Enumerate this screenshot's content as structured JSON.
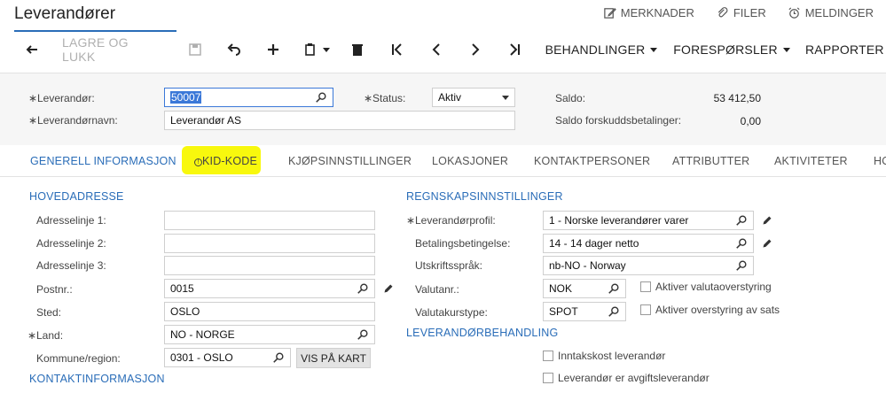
{
  "header": {
    "title": "Leverandører",
    "links": [
      {
        "label": "MERKNADER",
        "icon": "edit-note-icon"
      },
      {
        "label": "FILER",
        "icon": "paperclip-icon"
      },
      {
        "label": "MELDINGER",
        "icon": "alarm-clock-icon"
      }
    ]
  },
  "toolbar": {
    "save_close_label": "LAGRE OG LUKK",
    "actions_label": "BEHANDLINGER",
    "inquiries_label": "FORESPØRSLER",
    "reports_label": "RAPPORTER"
  },
  "summary": {
    "vendor_label": "Leverandør:",
    "vendor_value": "50007",
    "status_label": "Status:",
    "status_value": "Aktiv",
    "vendor_name_label": "Leverandørnavn:",
    "vendor_name_value": "Leverandør AS",
    "balance_label": "Saldo:",
    "balance_value": "53 412,50",
    "prepayment_label": "Saldo forskuddsbetalinger:",
    "prepayment_value": "0,00"
  },
  "tabs": [
    "GENERELL INFORMASJON",
    "KID-KODE",
    "KJØPSINNSTILLINGER",
    "LOKASJONER",
    "KONTAKTPERSONER",
    "ATTRIBUTTER",
    "AKTIVITETER",
    "HO"
  ],
  "address": {
    "section_title": "HOVEDADRESSE",
    "line1_label": "Adresselinje 1:",
    "line1_value": "",
    "line2_label": "Adresselinje 2:",
    "line2_value": "",
    "line3_label": "Adresselinje 3:",
    "line3_value": "",
    "postal_label": "Postnr.:",
    "postal_value": "0015",
    "city_label": "Sted:",
    "city_value": "OSLO",
    "country_label": "Land:",
    "country_value": "NO - NORGE",
    "municipality_label": "Kommune/region:",
    "municipality_value": "0301 - OSLO",
    "map_button": "VIS PÅ KART"
  },
  "contact": {
    "section_title": "KONTAKTINFORMASJON"
  },
  "accounting": {
    "section_title": "REGNSKAPSINNSTILLINGER",
    "profile_label": "Leverandørprofil:",
    "profile_value": "1 - Norske leverandører varer",
    "terms_label": "Betalingsbetingelse:",
    "terms_value": "14 - 14 dager netto",
    "language_label": "Utskriftsspråk:",
    "language_value": "nb-NO - Norway",
    "currency_label": "Valutanr.:",
    "currency_value": "NOK",
    "rate_type_label": "Valutakurstype:",
    "rate_type_value": "SPOT",
    "currency_override_label": "Aktiver valutaoverstyring",
    "rate_override_label": "Aktiver overstyring av sats"
  },
  "vendor_handling": {
    "section_title": "LEVERANDØRBEHANDLING",
    "landed_cost_label": "Inntakskost leverandør",
    "tax_agency_label": "Leverandør er avgiftsleverandør"
  },
  "colors": {
    "accent": "#2a6db8",
    "highlight": "#f8f800",
    "selection": "#3b78d8"
  }
}
